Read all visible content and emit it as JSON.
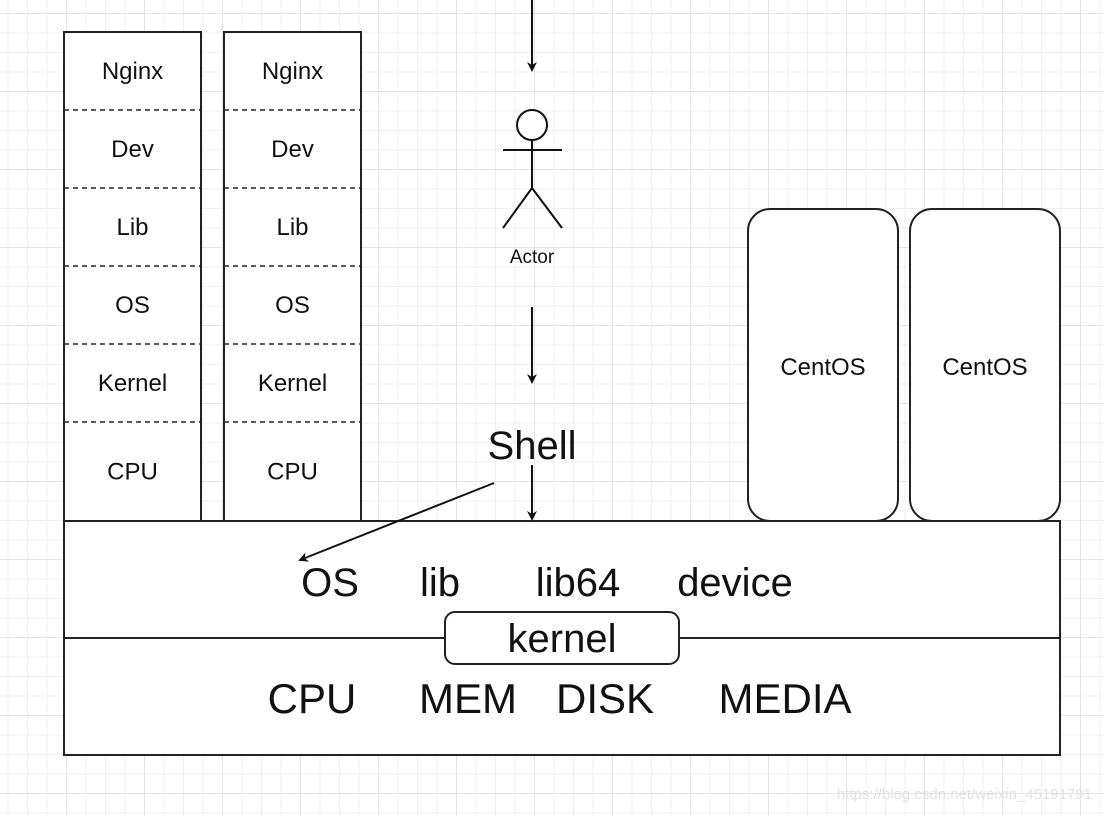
{
  "stacks": [
    {
      "layers": [
        "Nginx",
        "Dev",
        "Lib",
        "OS",
        "Kernel",
        "CPU"
      ]
    },
    {
      "layers": [
        "Nginx",
        "Dev",
        "Lib",
        "OS",
        "Kernel",
        "CPU"
      ]
    }
  ],
  "vms": [
    "CentOS",
    "CentOS"
  ],
  "actor_label": "Actor",
  "shell_label": "Shell",
  "os_layer": [
    "OS",
    "lib",
    "lib64",
    "device"
  ],
  "kernel_label": "kernel",
  "hardware_layer": [
    "CPU",
    "MEM",
    "DISK",
    "MEDIA"
  ],
  "watermark": "https://blog.csdn.net/weixin_45191791"
}
